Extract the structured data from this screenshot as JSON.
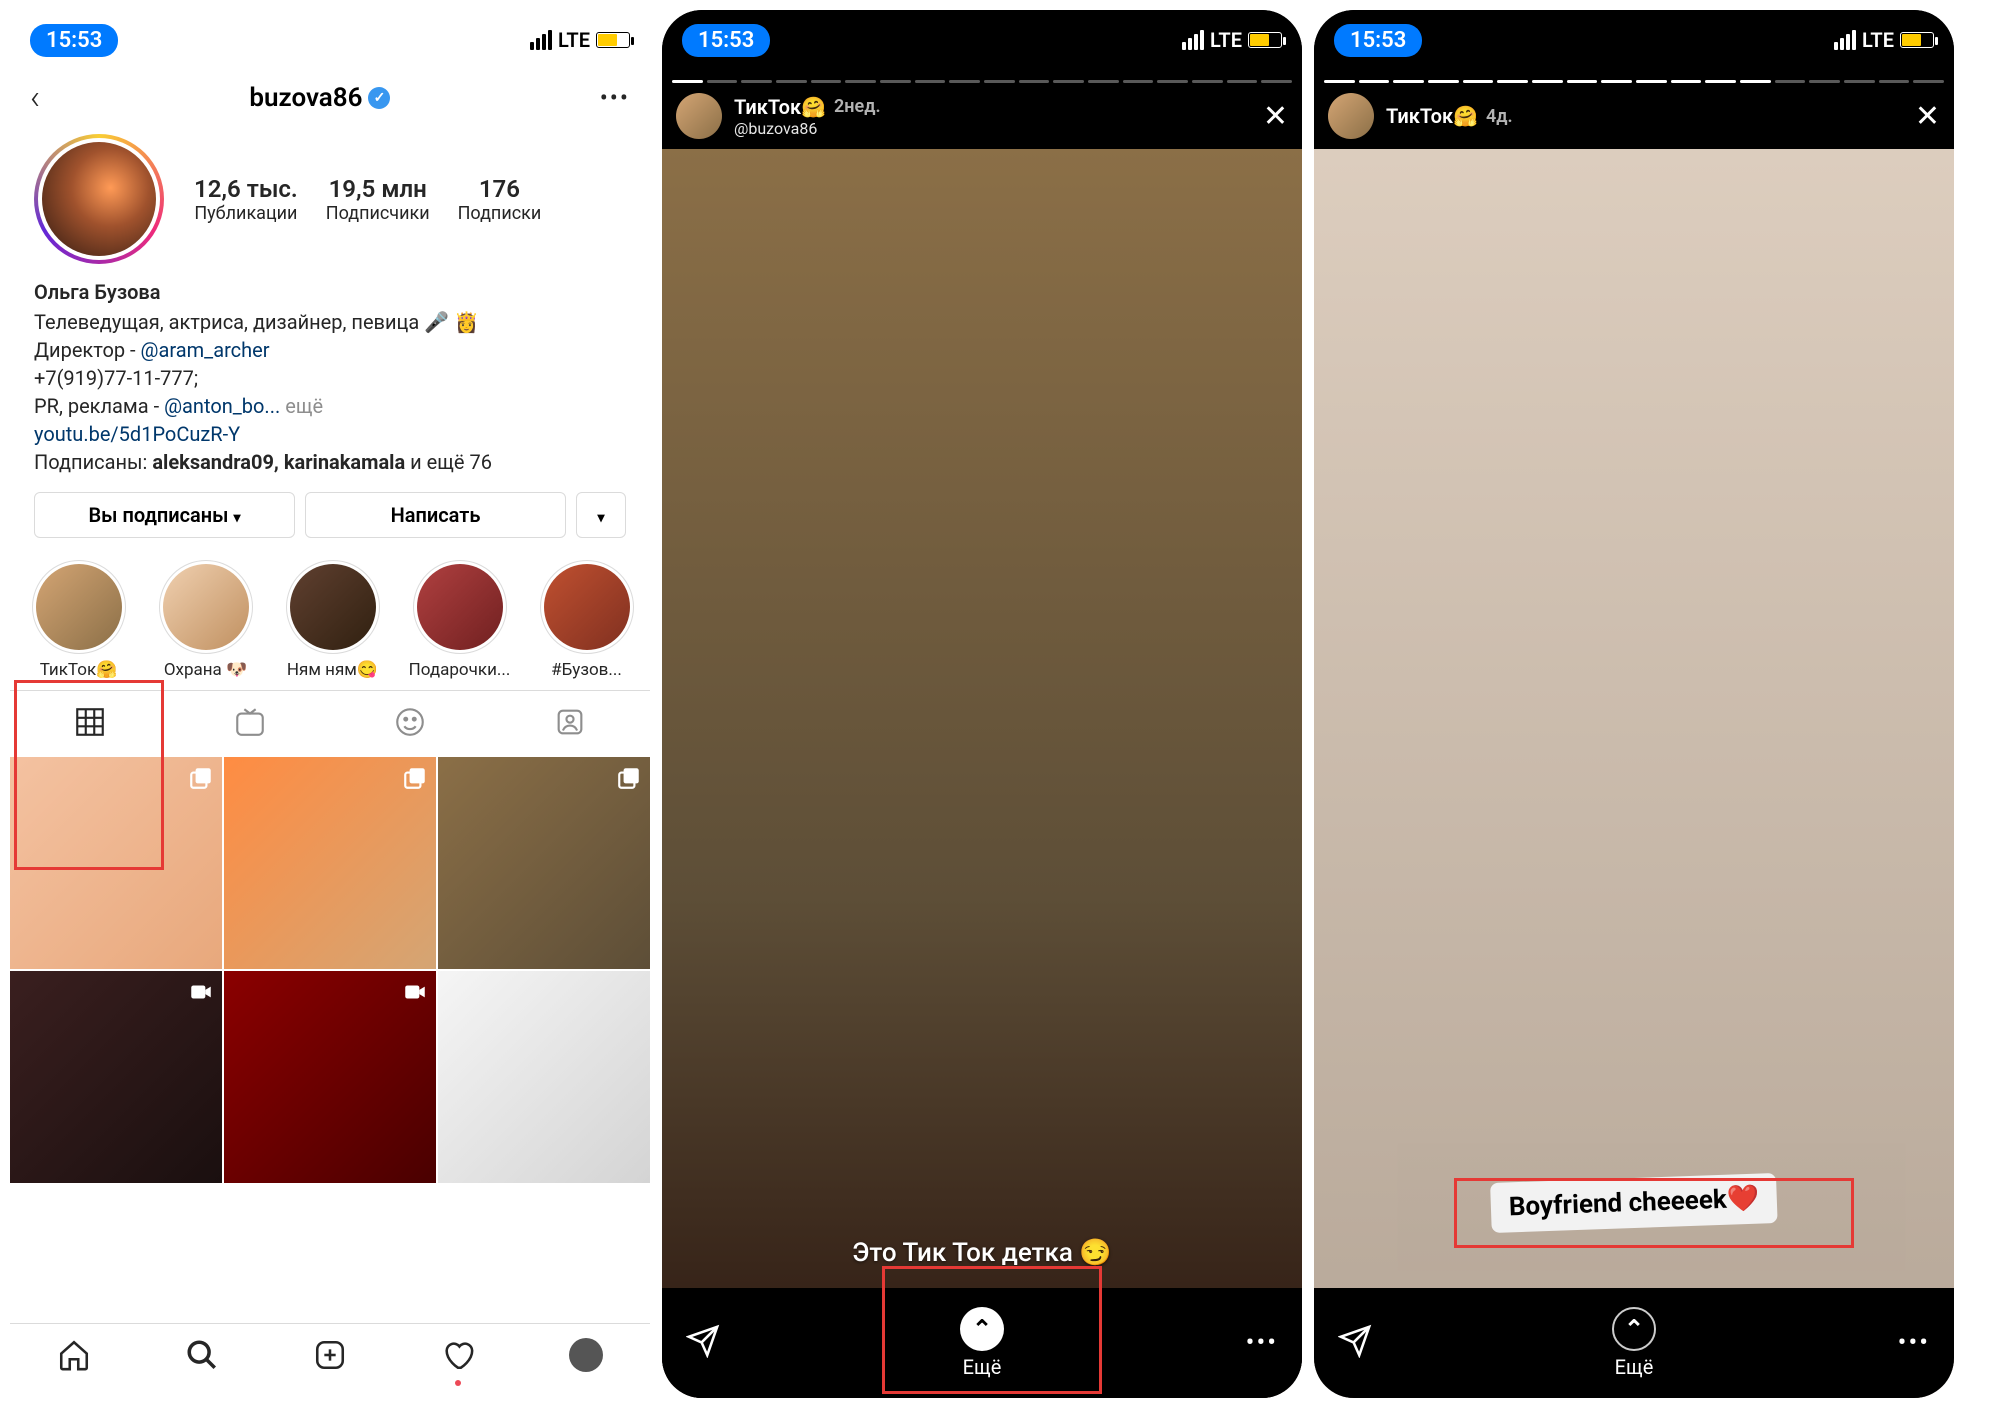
{
  "status": {
    "time": "15:53",
    "network": "LTE"
  },
  "profile": {
    "username": "buzova86",
    "verified": true,
    "stats": {
      "posts": {
        "value": "12,6 тыс.",
        "label": "Публикации"
      },
      "followers": {
        "value": "19,5 млн",
        "label": "Подписчики"
      },
      "following": {
        "value": "176",
        "label": "Подписки"
      }
    },
    "bio": {
      "name": "Ольга Бузова",
      "line1": "Телеведущая, актриса, дизайнер, певица 🎤 👸",
      "line2_prefix": "Директор - ",
      "line2_mention": "@aram_archer",
      "line3": "+7(919)77-11-777;",
      "line4_prefix": "PR, реклама - ",
      "line4_mention": "@anton_bo...",
      "more": " ещё",
      "link": "youtu.be/5d1PoCuzR-Y",
      "followed_by_prefix": "Подписаны: ",
      "followed_by_names": "aleksandra09, karinakamala",
      "followed_by_suffix": " и ещё 76"
    },
    "actions": {
      "following": "Вы подписаны",
      "message": "Написать"
    },
    "highlights": [
      {
        "label": "ТикТок🤗"
      },
      {
        "label": "Охрана 🐶"
      },
      {
        "label": "Ням ням😋"
      },
      {
        "label": "Подарочки..."
      },
      {
        "label": "#Бузов..."
      }
    ]
  },
  "story1": {
    "title": "ТикТок🤗",
    "subtitle": "@buzova86",
    "age": "2нед.",
    "caption": "Это Тик Ток детка 😏",
    "swipe_label": "Ещё"
  },
  "story2": {
    "title": "ТикТок🤗",
    "age": "4д.",
    "sticker": "Boyfriend cheeeek❤️",
    "swipe_label": "Ещё"
  }
}
